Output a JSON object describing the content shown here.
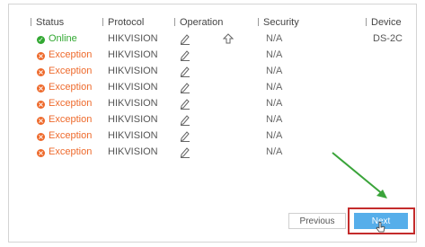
{
  "headers": {
    "status": "Status",
    "protocol": "Protocol",
    "operation": "Operation",
    "security": "Security",
    "device": "Device"
  },
  "rows": [
    {
      "status": "Online",
      "status_icon": "check-circle-icon",
      "status_color": "#32a832",
      "protocol": "HIKVISION",
      "security": "N/A",
      "device": "DS-2C"
    },
    {
      "status": "Exception",
      "status_icon": "x-circle-icon",
      "status_color": "#ee6a2c",
      "protocol": "HIKVISION",
      "security": "N/A",
      "device": ""
    },
    {
      "status": "Exception",
      "status_icon": "x-circle-icon",
      "status_color": "#ee6a2c",
      "protocol": "HIKVISION",
      "security": "N/A",
      "device": ""
    },
    {
      "status": "Exception",
      "status_icon": "x-circle-icon",
      "status_color": "#ee6a2c",
      "protocol": "HIKVISION",
      "security": "N/A",
      "device": ""
    },
    {
      "status": "Exception",
      "status_icon": "x-circle-icon",
      "status_color": "#ee6a2c",
      "protocol": "HIKVISION",
      "security": "N/A",
      "device": ""
    },
    {
      "status": "Exception",
      "status_icon": "x-circle-icon",
      "status_color": "#ee6a2c",
      "protocol": "HIKVISION",
      "security": "N/A",
      "device": ""
    },
    {
      "status": "Exception",
      "status_icon": "x-circle-icon",
      "status_color": "#ee6a2c",
      "protocol": "HIKVISION",
      "security": "N/A",
      "device": ""
    },
    {
      "status": "Exception",
      "status_icon": "x-circle-icon",
      "status_color": "#ee6a2c",
      "protocol": "HIKVISION",
      "security": "N/A",
      "device": ""
    }
  ],
  "buttons": {
    "previous": "Previous",
    "next": "Next"
  },
  "colors": {
    "accent": "#56aeea",
    "highlight": "#c42c2c",
    "arrow": "#3aa43a"
  }
}
